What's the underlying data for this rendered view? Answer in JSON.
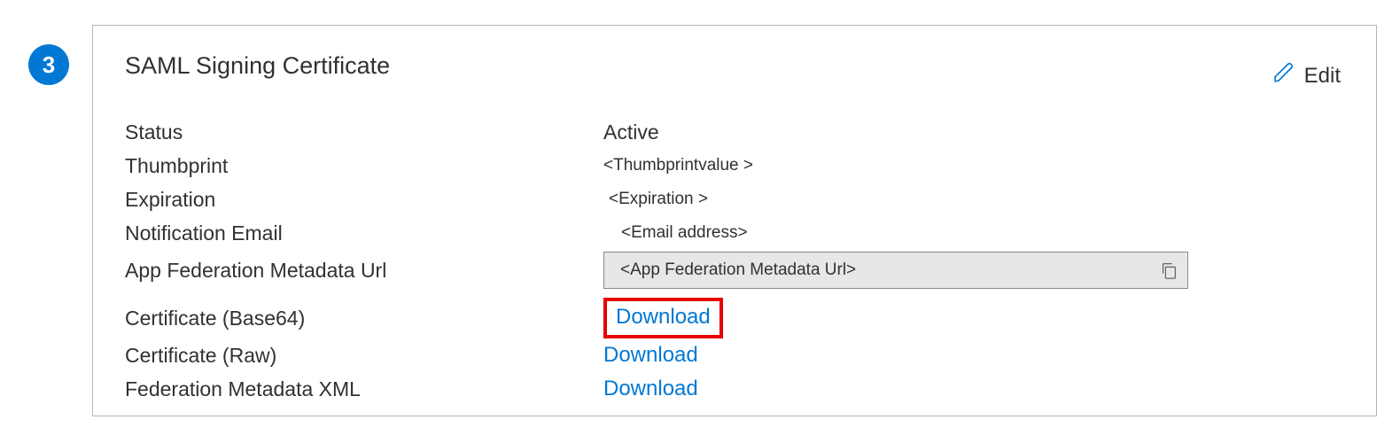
{
  "step_number": "3",
  "panel": {
    "title": "SAML Signing Certificate",
    "edit_label": "Edit"
  },
  "fields": {
    "status": {
      "label": "Status",
      "value": "Active"
    },
    "thumbprint": {
      "label": "Thumbprint",
      "value": "<Thumbprintvalue >"
    },
    "expiration": {
      "label": "Expiration",
      "value": "<Expiration >"
    },
    "notification_email": {
      "label": "Notification Email",
      "value": "<Email address>"
    },
    "app_fed_url": {
      "label": "App Federation Metadata Url",
      "value": "<App Federation Metadata Url>"
    },
    "cert_base64": {
      "label": "Certificate (Base64)",
      "link": "Download"
    },
    "cert_raw": {
      "label": "Certificate (Raw)",
      "link": "Download"
    },
    "fed_meta_xml": {
      "label": "Federation Metadata XML",
      "link": "Download"
    }
  }
}
